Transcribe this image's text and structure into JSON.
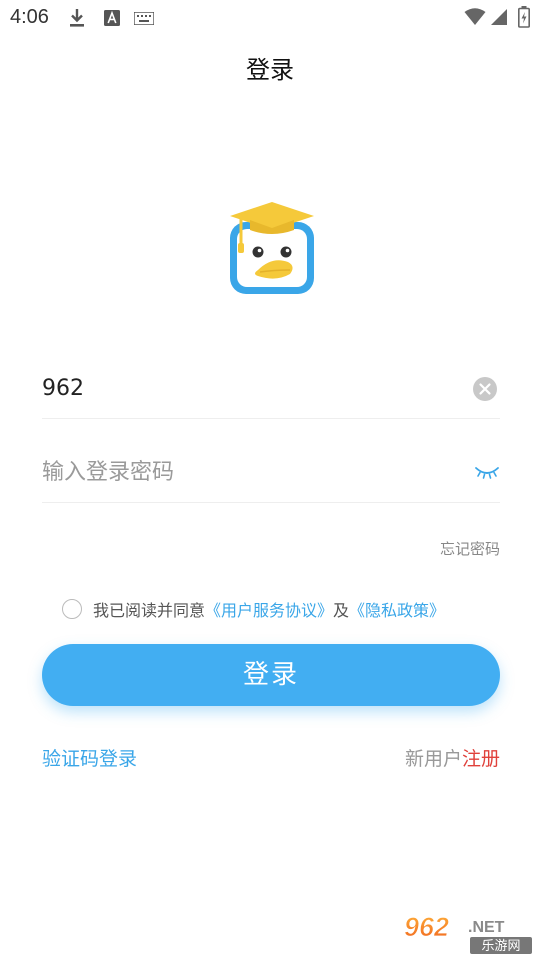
{
  "status_bar": {
    "time": "4:06"
  },
  "header": {
    "title": "登录"
  },
  "logo": {
    "icon": "duck-graduate-logo-icon"
  },
  "form": {
    "account_value": "962",
    "password_placeholder": "输入登录密码",
    "forgot_password": "忘记密码"
  },
  "agreement": {
    "prefix": "我已阅读并同意",
    "user_agreement": "《用户服务协议》",
    "conjunction": "及",
    "privacy_policy": "《隐私政策》"
  },
  "login_button": "登录",
  "footer": {
    "code_login": "验证码登录",
    "new_user": "新用户",
    "register": "注册"
  },
  "watermark": {
    "number": "962",
    "suffix": ".NET",
    "site": "乐游网"
  },
  "colors": {
    "accent": "#42aef2",
    "link": "#3aa6e8",
    "register": "#e0413b",
    "logo_yellow": "#f5c93a"
  }
}
